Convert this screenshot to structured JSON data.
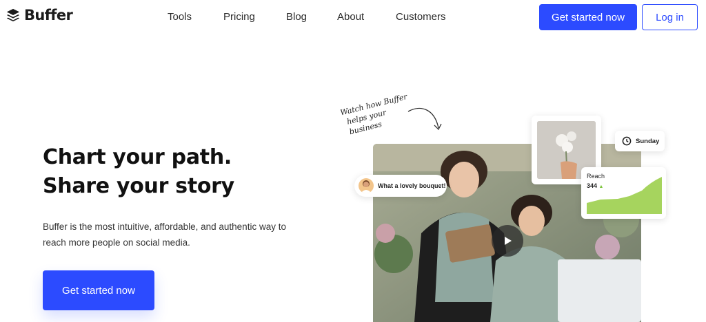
{
  "header": {
    "brand": "Buffer",
    "nav": [
      "Tools",
      "Pricing",
      "Blog",
      "About",
      "Customers"
    ],
    "cta_label": "Get started now",
    "login_label": "Log in"
  },
  "hero": {
    "title_line1": "Chart your path.",
    "title_line2": "Share your story",
    "subtitle": "Buffer is the most intuitive, affordable, and authentic way to reach more people on social media.",
    "cta_label": "Get started now"
  },
  "visual": {
    "watch_note_line1": "Watch how Buffer",
    "watch_note_line2": "helps your business",
    "comment": "What a lovely bouquet!",
    "day": "Sunday",
    "reach_label": "Reach",
    "reach_value": "344",
    "reach_trend_icon": "triangle-up-icon"
  },
  "colors": {
    "primary": "#2c4bff",
    "accent_green": "#a6d45e"
  }
}
